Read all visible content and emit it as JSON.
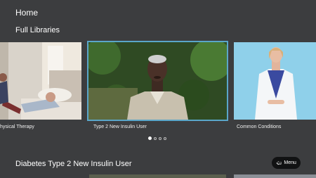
{
  "header": {
    "home": "Home",
    "section": "Full Libraries"
  },
  "carousel": {
    "items": [
      {
        "caption": "hysical Therapy"
      },
      {
        "caption": "Type 2 New Insulin User"
      },
      {
        "caption": "Common Conditions"
      }
    ],
    "page_count": 4,
    "active_page": 1
  },
  "row": {
    "title": "Diabetes Type 2 New Insulin User"
  },
  "menu": {
    "label": "Menu",
    "icon": "back-arrow-icon"
  },
  "colors": {
    "background": "#3c3d3f",
    "focus": "#5aa6c9"
  }
}
